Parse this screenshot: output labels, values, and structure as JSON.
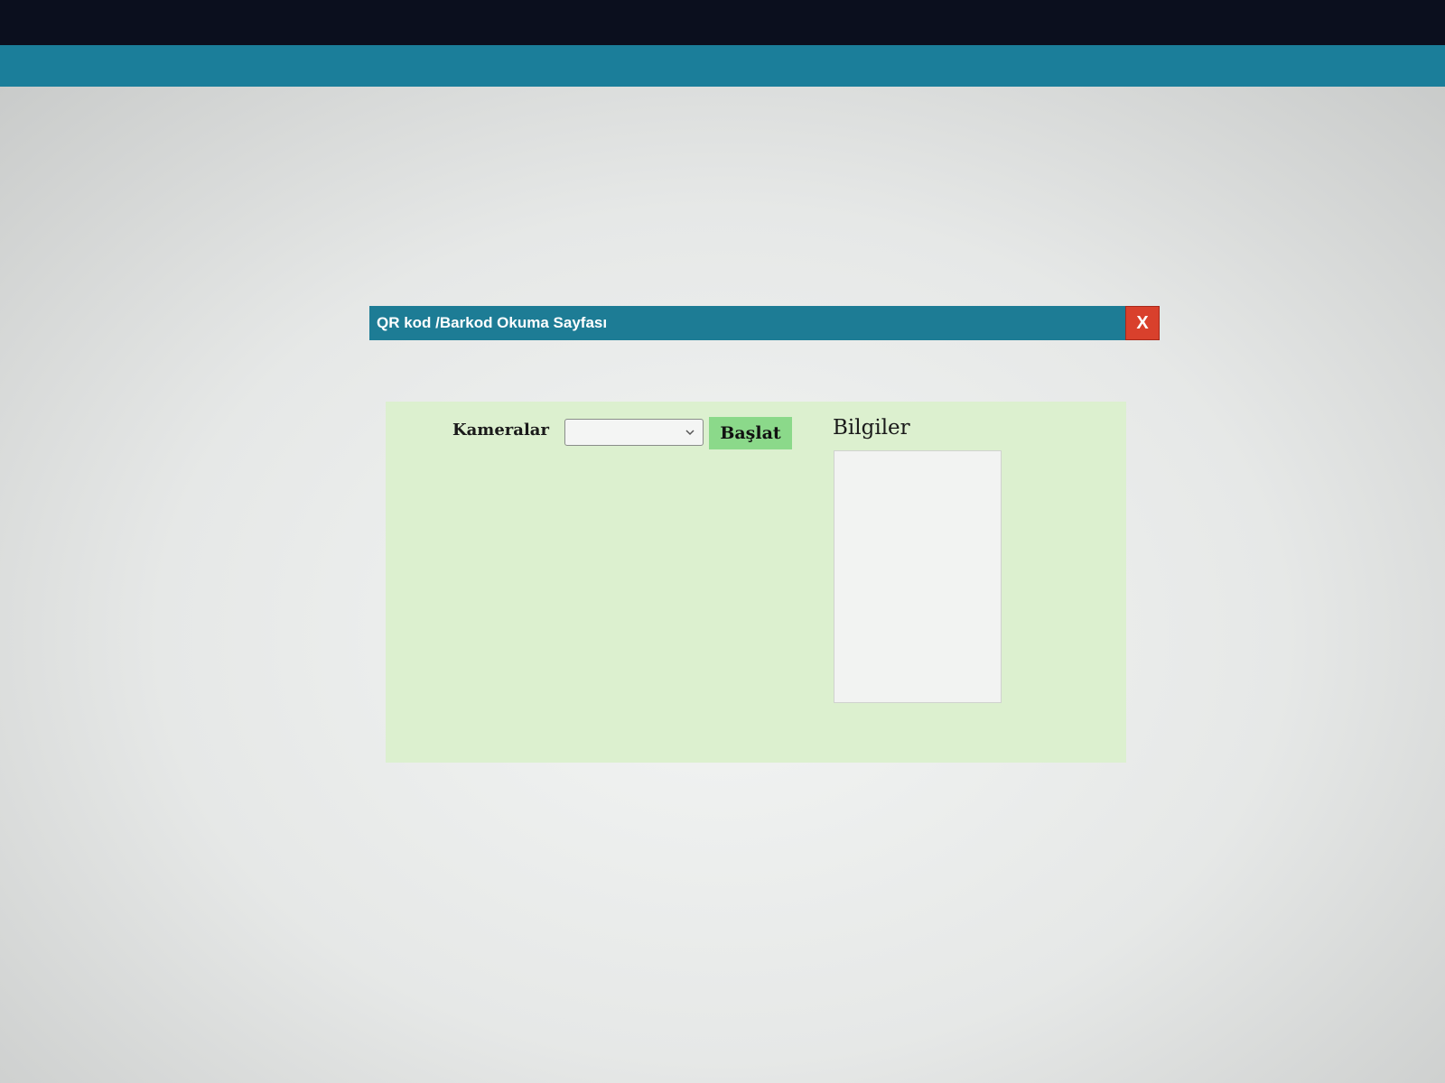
{
  "dialog": {
    "title": "QR kod /Barkod Okuma Sayfası",
    "close_label": "X"
  },
  "camera": {
    "label": "Kameralar",
    "selected": "",
    "icon": "chevron-down-icon"
  },
  "start_button": {
    "label": "Başlat"
  },
  "info": {
    "title": "Bilgiler",
    "value": ""
  },
  "colors": {
    "titlebar": "#1d7c95",
    "close": "#d9402c",
    "panel": "#dcf0cf",
    "start_button": "#8bd98a"
  }
}
